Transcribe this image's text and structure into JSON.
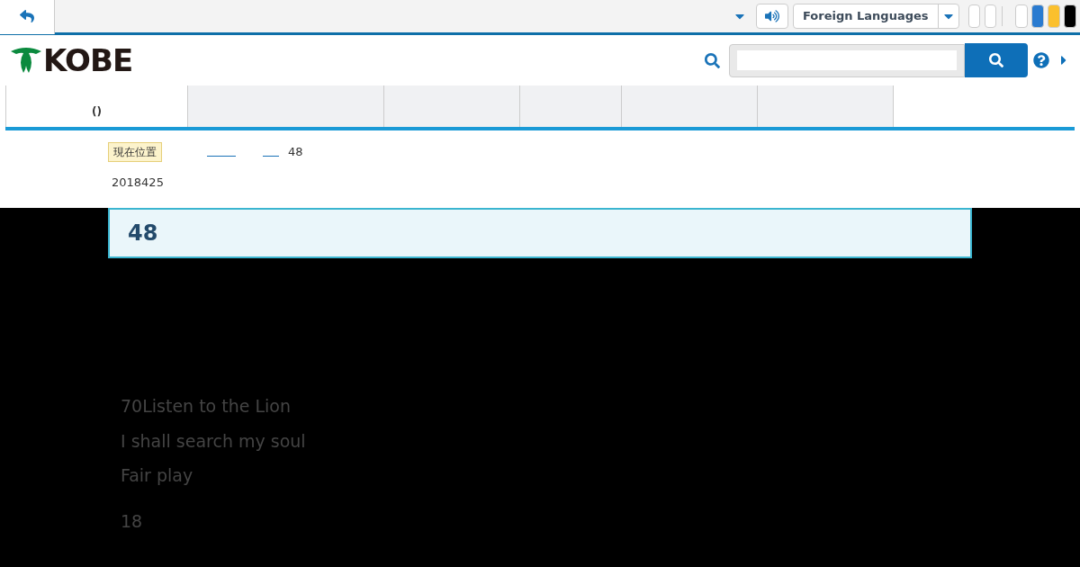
{
  "topbar": {
    "language": "Foreign Languages",
    "theme_swatches": [
      {
        "color": "#ffffff"
      },
      {
        "color": "#2a7bd0"
      },
      {
        "color": "#fbc02d"
      },
      {
        "color": "#000000"
      }
    ]
  },
  "logo": {
    "text": "KOBE"
  },
  "nav": [
    {
      "label": "()",
      "selected": true
    },
    {
      "selected": false
    },
    {
      "selected": false
    },
    {
      "selected": false
    },
    {
      "selected": false
    },
    {
      "selected": false
    }
  ],
  "breadcrumb": {
    "label": "現在位置",
    "current": "48"
  },
  "date": "2018425",
  "title": "48",
  "body": [
    "70Listen to the Lion",
    "I shall search my soul",
    "Fair play"
  ],
  "footer_text": "18"
}
